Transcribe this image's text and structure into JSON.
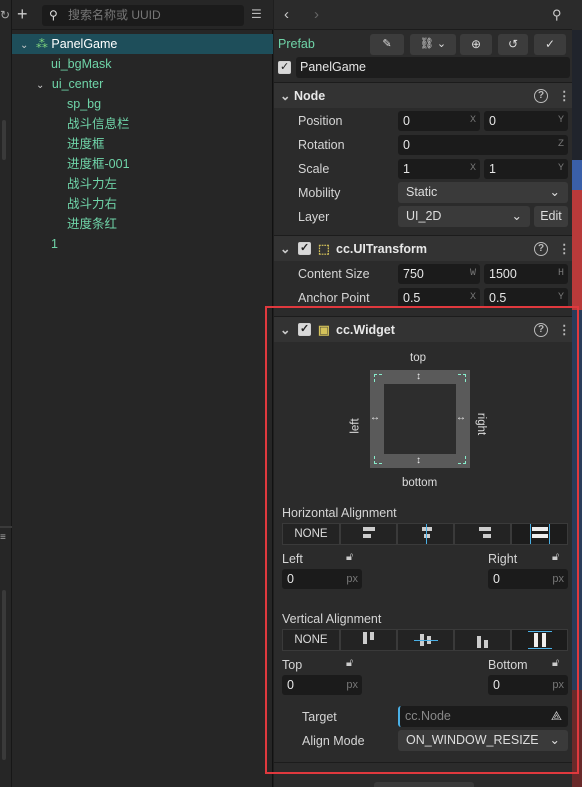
{
  "hierarchy": {
    "search_placeholder": "搜索名称或 UUID",
    "items": [
      {
        "label": "PanelGame"
      },
      {
        "label": "ui_bgMask"
      },
      {
        "label": "ui_center"
      },
      {
        "label": "sp_bg"
      },
      {
        "label": "战斗信息栏"
      },
      {
        "label": "进度框"
      },
      {
        "label": "进度框-001"
      },
      {
        "label": "战斗力左"
      },
      {
        "label": "战斗力右"
      },
      {
        "label": "进度条红"
      },
      {
        "label": "1"
      }
    ]
  },
  "inspector": {
    "prefab_label": "Prefab",
    "node_name": "PanelGame",
    "node_section": {
      "title": "Node",
      "position_label": "Position",
      "position_x": "0",
      "position_y": "0",
      "rotation_label": "Rotation",
      "rotation_z": "0",
      "scale_label": "Scale",
      "scale_x": "1",
      "scale_y": "1",
      "mobility_label": "Mobility",
      "mobility_value": "Static",
      "layer_label": "Layer",
      "layer_value": "UI_2D",
      "edit_label": "Edit"
    },
    "uitransform": {
      "title": "cc.UITransform",
      "content_size_label": "Content Size",
      "width": "750",
      "height": "1500",
      "anchor_label": "Anchor Point",
      "anchor_x": "0.5",
      "anchor_y": "0.5"
    },
    "widget": {
      "title": "cc.Widget",
      "top_label": "top",
      "bottom_label": "bottom",
      "left_label": "left",
      "right_label": "right",
      "h_align_label": "Horizontal Alignment",
      "h_none": "NONE",
      "left_field_label": "Left",
      "left_value": "0",
      "right_field_label": "Right",
      "right_value": "0",
      "v_align_label": "Vertical Alignment",
      "v_none": "NONE",
      "top_field_label": "Top",
      "top_value": "0",
      "bottom_field_label": "Bottom",
      "bottom_value": "0",
      "px": "px",
      "target_label": "Target",
      "target_value": "cc.Node",
      "align_mode_label": "Align Mode",
      "align_mode_value": "ON_WINDOW_RESIZE"
    },
    "axes": {
      "x": "X",
      "y": "Y",
      "z": "Z",
      "w": "W",
      "h": "H"
    }
  },
  "colors": {
    "tree_text": "#6fd4a8",
    "selected_row": "#1e4e5a",
    "highlight_box": "#e0393e",
    "accent": "#4ab0e6"
  }
}
